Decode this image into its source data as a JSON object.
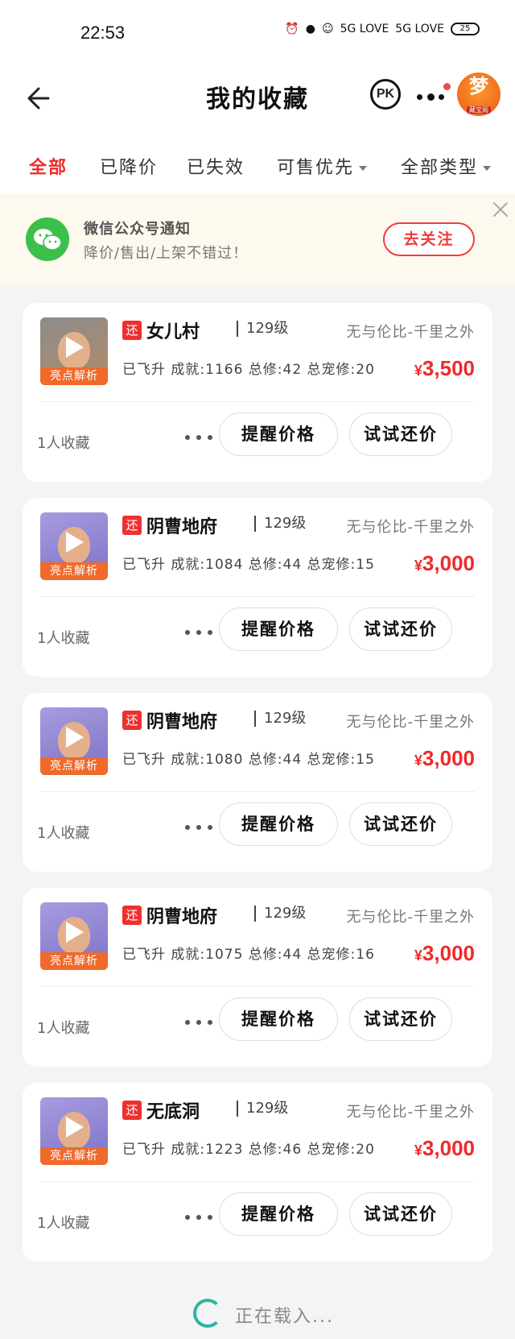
{
  "status_bar": {
    "time": "22:53",
    "signal1": "5G LOVE",
    "signal2": "5G LOVE",
    "battery": "25"
  },
  "nav": {
    "title": "我的收藏",
    "pk_label": "PK",
    "avatar_char": "梦",
    "avatar_sub": "藏宝阁"
  },
  "tabs": [
    {
      "label": "全部",
      "active": true
    },
    {
      "label": "已降价"
    },
    {
      "label": "已失效"
    },
    {
      "label": "可售优先",
      "dropdown": true
    },
    {
      "label": "全部类型",
      "dropdown": true
    }
  ],
  "notice": {
    "title": "微信公众号通知",
    "subtitle": "降价/售出/上架不错过！",
    "button": "去关注"
  },
  "cards": [
    {
      "badge": "还",
      "name": "女儿村",
      "level": "129级",
      "server": "无与伦比-千里之外",
      "stats": "已飞升 成就:1166 总修:42 总宠修:20",
      "currency": "¥",
      "price": "3,500",
      "thumb_tag": "亮点解析",
      "fav": "1人收藏",
      "remind": "提醒价格",
      "counter": "试试还价"
    },
    {
      "badge": "还",
      "name": "阴曹地府",
      "level": "129级",
      "server": "无与伦比-千里之外",
      "stats": "已飞升 成就:1084 总修:44 总宠修:15",
      "currency": "¥",
      "price": "3,000",
      "thumb_tag": "亮点解析",
      "fav": "1人收藏",
      "remind": "提醒价格",
      "counter": "试试还价"
    },
    {
      "badge": "还",
      "name": "阴曹地府",
      "level": "129级",
      "server": "无与伦比-千里之外",
      "stats": "已飞升 成就:1080 总修:44 总宠修:15",
      "currency": "¥",
      "price": "3,000",
      "thumb_tag": "亮点解析",
      "fav": "1人收藏",
      "remind": "提醒价格",
      "counter": "试试还价"
    },
    {
      "badge": "还",
      "name": "阴曹地府",
      "level": "129级",
      "server": "无与伦比-千里之外",
      "stats": "已飞升 成就:1075 总修:44 总宠修:16",
      "currency": "¥",
      "price": "3,000",
      "thumb_tag": "亮点解析",
      "fav": "1人收藏",
      "remind": "提醒价格",
      "counter": "试试还价"
    },
    {
      "badge": "还",
      "name": "无底洞",
      "level": "129级",
      "server": "无与伦比-千里之外",
      "stats": "已飞升 成就:1223 总修:46 总宠修:20",
      "currency": "¥",
      "price": "3,000",
      "thumb_tag": "亮点解析",
      "fav": "1人收藏",
      "remind": "提醒价格",
      "counter": "试试还价"
    }
  ],
  "loading": "正在载入..."
}
